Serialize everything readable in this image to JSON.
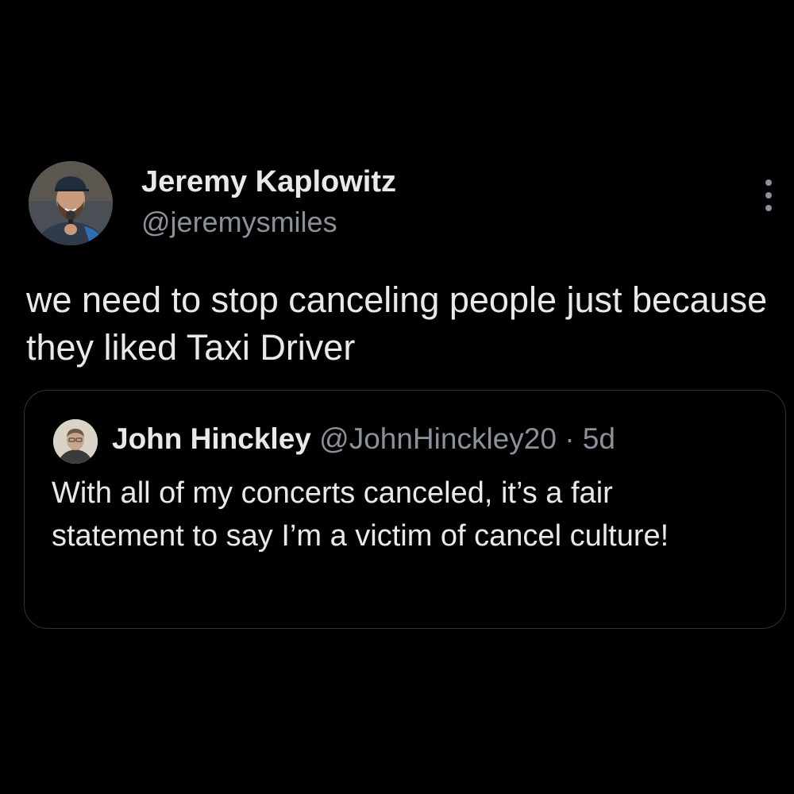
{
  "tweet": {
    "author_name": "Jeremy Kaplowitz",
    "author_handle": "@jeremysmiles",
    "avatar_icon": "avatar-jeremy",
    "more_icon": "more-vertical-icon",
    "text": "we need to stop canceling people just because they liked Taxi Driver"
  },
  "quoted_tweet": {
    "author_name": "John Hinckley",
    "author_handle": "@JohnHinckley20",
    "separator": "·",
    "time": "5d",
    "avatar_icon": "avatar-john",
    "text": "With all of my concerts canceled, it’s a fair statement to say I’m a victim of cancel culture!"
  },
  "colors": {
    "background": "#000000",
    "primary_text": "#e7e9ea",
    "secondary_text": "#8b9199",
    "border": "#2f3336"
  }
}
